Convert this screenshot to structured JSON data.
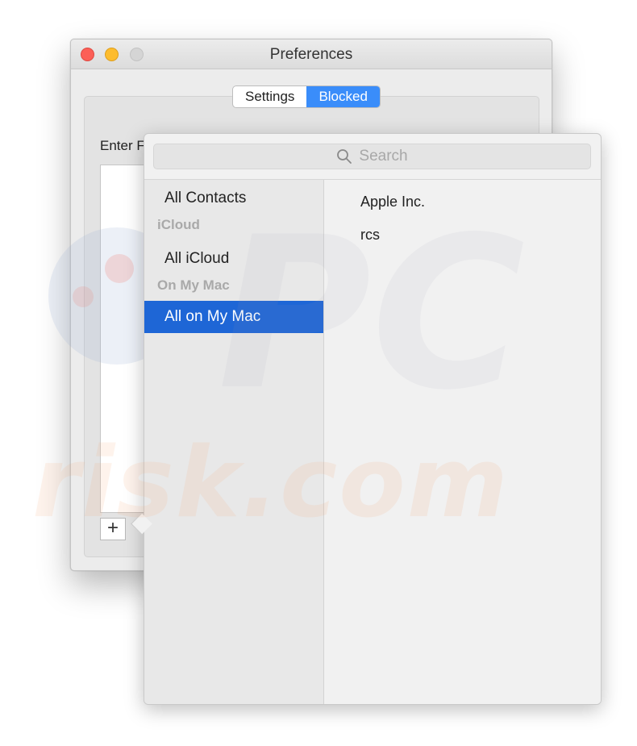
{
  "window": {
    "title": "Preferences",
    "tabs": [
      {
        "label": "Settings",
        "active": false
      },
      {
        "label": "Blocked",
        "active": true
      }
    ],
    "enter_label": "Enter F",
    "add_button": "+"
  },
  "popover": {
    "search": {
      "placeholder": "Search",
      "icon": "search-icon"
    },
    "sidebar": {
      "items": [
        {
          "type": "item",
          "label": "All Contacts"
        },
        {
          "type": "header",
          "label": "iCloud"
        },
        {
          "type": "item",
          "label": "All iCloud"
        },
        {
          "type": "header",
          "label": "On My Mac"
        },
        {
          "type": "item",
          "label": "All on My Mac",
          "selected": true
        }
      ]
    },
    "contacts": [
      "Apple Inc.",
      "rcs"
    ]
  },
  "watermark": {
    "text_1": "PC",
    "text_2": "risk.com"
  },
  "colors": {
    "accent": "#3a8dfa",
    "selection": "#1e66d6",
    "close": "#fc5f57",
    "minimize": "#fdbc2e"
  }
}
